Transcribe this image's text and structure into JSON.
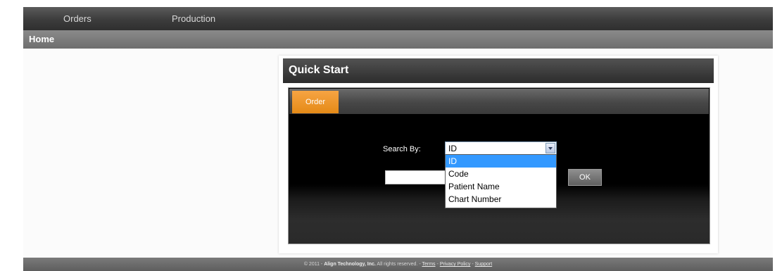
{
  "nav": {
    "items": [
      "Orders",
      "Production"
    ]
  },
  "subnav": {
    "breadcrumb": "Home"
  },
  "quick_start": {
    "title": "Quick Start",
    "tabs": [
      "Order"
    ],
    "search_label": "Search By:",
    "select": {
      "selected": "ID",
      "options": [
        "ID",
        "Code",
        "Patient Name",
        "Chart Number"
      ],
      "highlighted_index": 0
    },
    "search_input": {
      "value": ""
    },
    "ok_label": "OK"
  },
  "footer": {
    "copyright": "© 2011 -",
    "company": "Align Technology, Inc.",
    "rights": "All rights reserved. -",
    "links": [
      "Terms",
      "Privacy Policy",
      "Support"
    ],
    "separator": "-"
  },
  "colors": {
    "tab_active": "#e58a17",
    "selection": "#3399ff"
  }
}
